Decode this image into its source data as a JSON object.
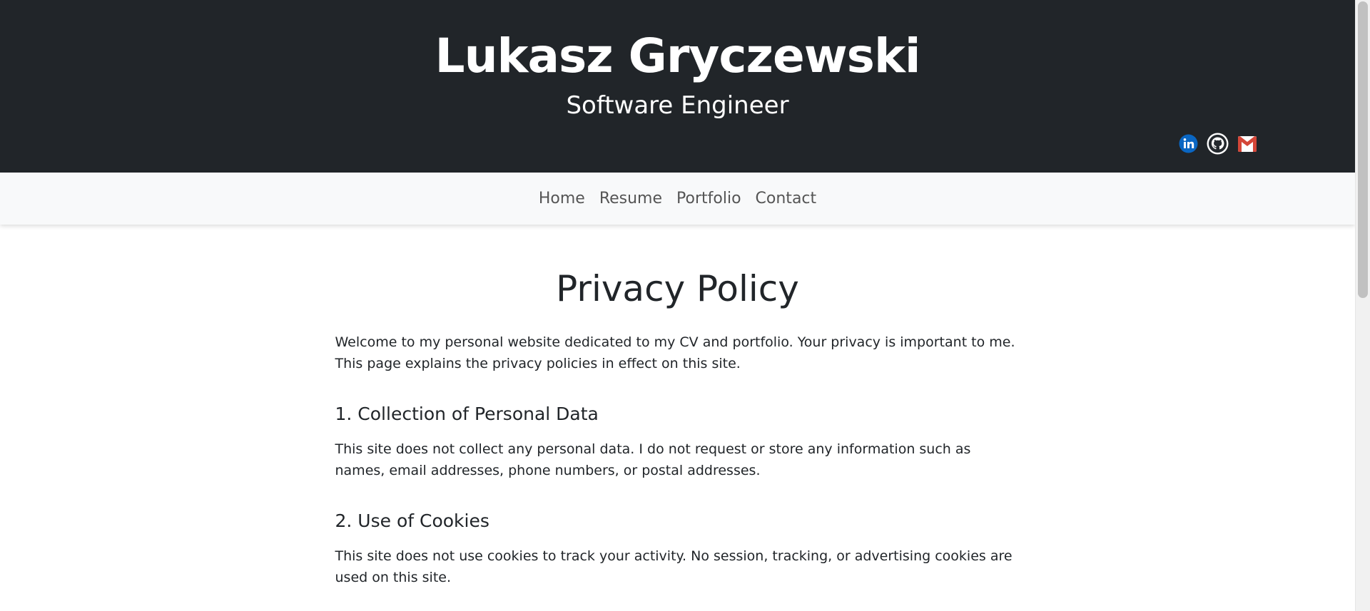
{
  "header": {
    "name": "Lukasz Gryczewski",
    "subtitle": "Software Engineer",
    "social": [
      {
        "icon": "linkedin-icon",
        "color": "#0a66c2"
      },
      {
        "icon": "github-icon",
        "color": "#24292e"
      },
      {
        "icon": "gmail-icon",
        "color": "#d44638"
      }
    ]
  },
  "nav": {
    "items": [
      "Home",
      "Resume",
      "Portfolio",
      "Contact"
    ]
  },
  "main": {
    "title": "Privacy Policy",
    "intro": "Welcome to my personal website dedicated to my CV and portfolio. Your privacy is important to me. This page explains the privacy policies in effect on this site.",
    "sections": [
      {
        "heading": "1. Collection of Personal Data",
        "body": "This site does not collect any personal data. I do not request or store any information such as names, email addresses, phone numbers, or postal addresses."
      },
      {
        "heading": "2. Use of Cookies",
        "body": "This site does not use cookies to track your activity. No session, tracking, or advertising cookies are used on this site."
      }
    ]
  },
  "colors": {
    "header_bg": "#212529",
    "nav_bg": "#f8f9fa",
    "text": "#212529",
    "nav_text": "#555555"
  }
}
